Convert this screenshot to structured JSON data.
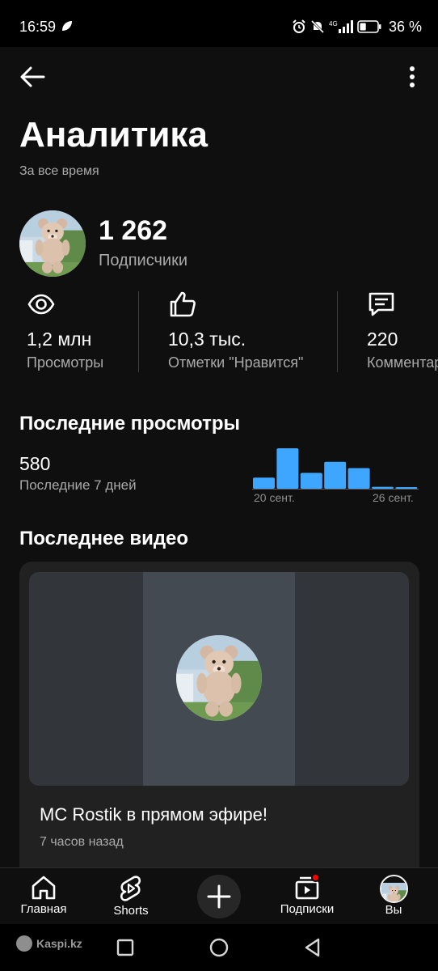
{
  "status_bar": {
    "time": "16:59",
    "network": "4G",
    "battery_percent": "36 %",
    "battery_level": 0.36
  },
  "header": {
    "back_icon": "arrow-left-icon",
    "more_icon": "more-vertical-icon"
  },
  "page": {
    "title": "Аналитика",
    "subtitle": "За все время"
  },
  "channel": {
    "subscribers_value": "1 262",
    "subscribers_label": "Подписчики"
  },
  "stats": [
    {
      "icon": "eye-icon",
      "value": "1,2 млн",
      "label": "Просмотры"
    },
    {
      "icon": "thumbs-up-icon",
      "value": "10,3 тыс.",
      "label": "Отметки \"Нравится\""
    },
    {
      "icon": "comment-icon",
      "value": "220",
      "label": "Комментар"
    }
  ],
  "recent_views": {
    "title": "Последние просмотры",
    "value": "580",
    "period": "Последние 7 дней",
    "chart_data": {
      "type": "bar",
      "categories": [
        "20 сент.",
        "21 сент.",
        "22 сент.",
        "23 сент.",
        "24 сент.",
        "25 сент.",
        "26 сент."
      ],
      "tick_labels": [
        "20 сент.",
        "26 сент."
      ],
      "values": [
        70,
        255,
        100,
        170,
        130,
        12,
        10
      ],
      "color": "#3ea6ff",
      "grid": false
    }
  },
  "latest_video": {
    "section_title": "Последнее видео",
    "title": "MC Rostik в прямом эфире!",
    "time_ago": "7 часов назад"
  },
  "bottom_nav": {
    "home": "Главная",
    "shorts": "Shorts",
    "create_icon": "plus-icon",
    "subscriptions": "Подписки",
    "you": "Вы"
  },
  "system_nav": {
    "watermark": "Kaspi.kz"
  },
  "colors": {
    "background": "#0f0f0f",
    "text_primary": "#f1f1f1",
    "text_secondary": "#aaaaaa",
    "accent_bar": "#3ea6ff",
    "notification": "#ff0000"
  }
}
